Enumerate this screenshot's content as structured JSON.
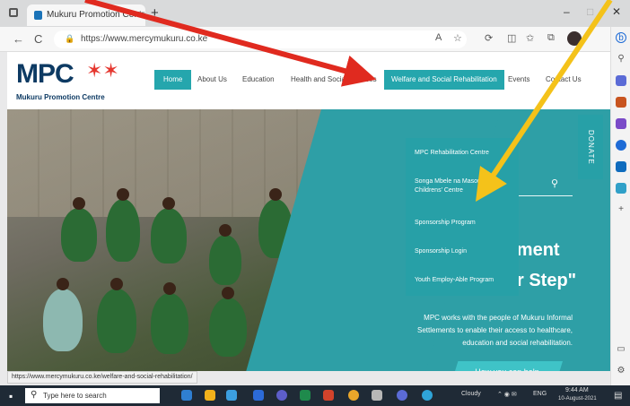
{
  "browser": {
    "tab_title": "Mukuru Promotion Centre",
    "tab_close": "×",
    "new_tab": "+",
    "url": "https://www.mercymukuru.co.ke",
    "status_url": "https://www.mercymukuru.co.ke/welfare-and-social-rehabilitation/",
    "minimize": "–",
    "maximize": "□",
    "close": "✕",
    "back": "←",
    "refresh": "C"
  },
  "site": {
    "logo": "MPC",
    "logo_subtitle": "Mukuru Promotion Centre",
    "nav": {
      "home": "Home",
      "about": "About Us",
      "education": "Education",
      "health": "Health and Social Services",
      "welfare": "Welfare and Social Rehabilitation",
      "events": "Events",
      "contact": "Contact Us"
    },
    "dropdown": {
      "item1": "MPC Rehabilitation Centre",
      "item2": "Songa Mbele na Masomo Childrens' Centre",
      "item3": "Sponsorship Program",
      "item4": "Sponsorship Login",
      "item5": "Youth Employ-Able Program"
    },
    "donate": "DONATE",
    "hero_title_line1": "rment",
    "hero_title_line2": "r Step\"",
    "hero_body": "MPC works with the people of Mukuru Informal Settlements to enable their access to healthcare, education and social rehabilitation.",
    "cta": "How you can help"
  },
  "taskbar": {
    "search_placeholder": "Type here to search",
    "tray_weather": "Cloudy",
    "tray_lang": "ENG",
    "tray_time": "9:44 AM",
    "tray_date": "10-August-2021"
  },
  "colors": {
    "teal": "#2e9fa6",
    "navy": "#0d3a63",
    "red_arrow": "#e02a1f",
    "yellow_arrow": "#f4c21a"
  }
}
